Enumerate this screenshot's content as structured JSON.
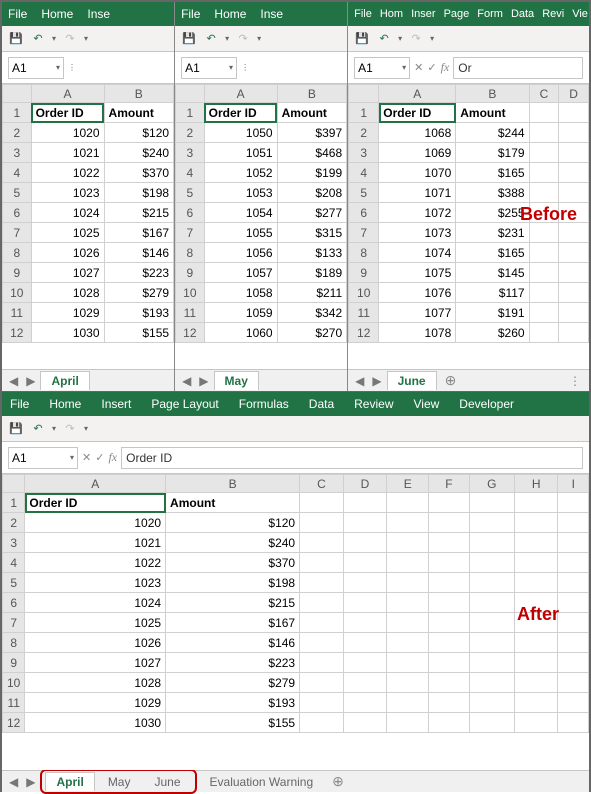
{
  "upper": {
    "ribbon_small": [
      "File",
      "Home",
      "Inse"
    ],
    "ribbon_small3": [
      "File",
      "Hom",
      "Inser",
      "Page",
      "Form",
      "Data",
      "Revi",
      "Vie"
    ],
    "namebox": "A1",
    "fx": "fx",
    "formula_value": "Or",
    "headers": [
      "Order ID",
      "Amount"
    ],
    "col_labels": [
      "A",
      "B",
      "C",
      "D"
    ],
    "windows": [
      {
        "tab": "April",
        "rows": [
          [
            "1020",
            "$120"
          ],
          [
            "1021",
            "$240"
          ],
          [
            "1022",
            "$370"
          ],
          [
            "1023",
            "$198"
          ],
          [
            "1024",
            "$215"
          ],
          [
            "1025",
            "$167"
          ],
          [
            "1026",
            "$146"
          ],
          [
            "1027",
            "$223"
          ],
          [
            "1028",
            "$279"
          ],
          [
            "1029",
            "$193"
          ],
          [
            "1030",
            "$155"
          ]
        ]
      },
      {
        "tab": "May",
        "rows": [
          [
            "1050",
            "$397"
          ],
          [
            "1051",
            "$468"
          ],
          [
            "1052",
            "$199"
          ],
          [
            "1053",
            "$208"
          ],
          [
            "1054",
            "$277"
          ],
          [
            "1055",
            "$315"
          ],
          [
            "1056",
            "$133"
          ],
          [
            "1057",
            "$189"
          ],
          [
            "1058",
            "$211"
          ],
          [
            "1059",
            "$342"
          ],
          [
            "1060",
            "$270"
          ]
        ]
      },
      {
        "tab": "June",
        "rows": [
          [
            "1068",
            "$244"
          ],
          [
            "1069",
            "$179"
          ],
          [
            "1070",
            "$165"
          ],
          [
            "1071",
            "$388"
          ],
          [
            "1072",
            "$255"
          ],
          [
            "1073",
            "$231"
          ],
          [
            "1074",
            "$165"
          ],
          [
            "1075",
            "$145"
          ],
          [
            "1076",
            "$117"
          ],
          [
            "1077",
            "$191"
          ],
          [
            "1078",
            "$260"
          ]
        ]
      }
    ],
    "annotation": "Before"
  },
  "lower": {
    "ribbon": [
      "File",
      "Home",
      "Insert",
      "Page Layout",
      "Formulas",
      "Data",
      "Review",
      "View",
      "Developer"
    ],
    "namebox": "A1",
    "fx": "fx",
    "formula_value": "Order ID",
    "col_labels": [
      "A",
      "B",
      "C",
      "D",
      "E",
      "F",
      "G",
      "H",
      "I"
    ],
    "headers": [
      "Order ID",
      "Amount"
    ],
    "rows": [
      [
        "1020",
        "$120"
      ],
      [
        "1021",
        "$240"
      ],
      [
        "1022",
        "$370"
      ],
      [
        "1023",
        "$198"
      ],
      [
        "1024",
        "$215"
      ],
      [
        "1025",
        "$167"
      ],
      [
        "1026",
        "$146"
      ],
      [
        "1027",
        "$223"
      ],
      [
        "1028",
        "$279"
      ],
      [
        "1029",
        "$193"
      ],
      [
        "1030",
        "$155"
      ]
    ],
    "tabs": [
      "April",
      "May",
      "June"
    ],
    "eval_tab": "Evaluation Warning",
    "annotation": "After"
  },
  "icons": {
    "save": "💾",
    "undo": "↶",
    "redo": "↷",
    "dropdown": "▾",
    "xmark": "✕",
    "check": "✓",
    "left": "◀",
    "right": "▶",
    "plus": "⊕",
    "dots": "⋮"
  },
  "chart_data": {
    "type": "table",
    "description": "Three Excel workbooks (April/May/June) merged into one workbook with three sheet tabs",
    "before": {
      "April": {
        "Order ID": [
          1020,
          1021,
          1022,
          1023,
          1024,
          1025,
          1026,
          1027,
          1028,
          1029,
          1030
        ],
        "Amount": [
          120,
          240,
          370,
          198,
          215,
          167,
          146,
          223,
          279,
          193,
          155
        ]
      },
      "May": {
        "Order ID": [
          1050,
          1051,
          1052,
          1053,
          1054,
          1055,
          1056,
          1057,
          1058,
          1059,
          1060
        ],
        "Amount": [
          397,
          468,
          199,
          208,
          277,
          315,
          133,
          189,
          211,
          342,
          270
        ]
      },
      "June": {
        "Order ID": [
          1068,
          1069,
          1070,
          1071,
          1072,
          1073,
          1074,
          1075,
          1076,
          1077,
          1078
        ],
        "Amount": [
          244,
          179,
          165,
          388,
          255,
          231,
          165,
          145,
          117,
          191,
          260
        ]
      }
    },
    "after_tabs": [
      "April",
      "May",
      "June",
      "Evaluation Warning"
    ]
  }
}
